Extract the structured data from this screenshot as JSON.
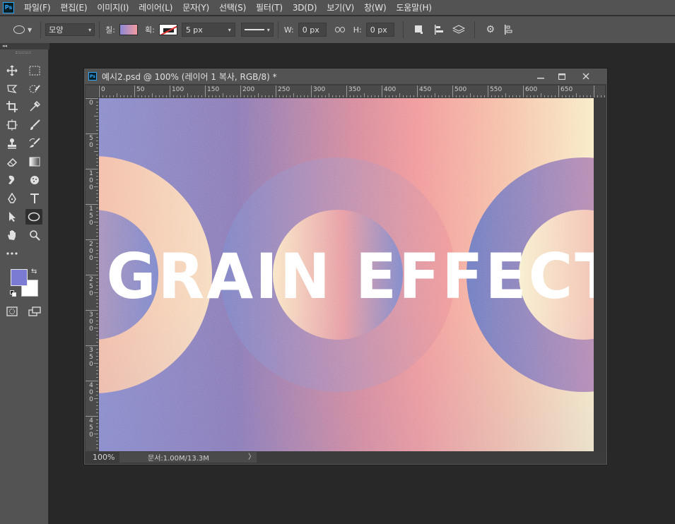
{
  "app": {
    "logo": "Ps"
  },
  "menu": [
    "파일(F)",
    "편집(E)",
    "이미지(I)",
    "레이어(L)",
    "문자(Y)",
    "선택(S)",
    "필터(T)",
    "3D(D)",
    "보기(V)",
    "창(W)",
    "도움말(H)"
  ],
  "options": {
    "shape_mode": "모양",
    "fill_label": "칠:",
    "stroke_label": "획:",
    "stroke_width": "5 px",
    "w_label": "W:",
    "w_value": "0 px",
    "h_label": "H:",
    "h_value": "0 px"
  },
  "panel": {
    "collapse": "◂◂"
  },
  "colors": {
    "foreground": "#7c7bd3",
    "background": "#ffffff"
  },
  "document": {
    "title": "예시2.psd @ 100% (레이어 1 복사, RGB/8) *",
    "ruler_h": [
      "0",
      "50",
      "100",
      "150",
      "200",
      "250",
      "300",
      "350",
      "400",
      "450",
      "500",
      "550",
      "600",
      "650"
    ],
    "ruler_v": [
      "0",
      "50",
      "100",
      "150",
      "200",
      "250",
      "300",
      "350",
      "400",
      "450"
    ],
    "canvas_text": "GRAIN EFFECT",
    "status": {
      "zoom": "100%",
      "doc_info": "문서:1.00M/13.3M",
      "arrow": "〉"
    }
  }
}
